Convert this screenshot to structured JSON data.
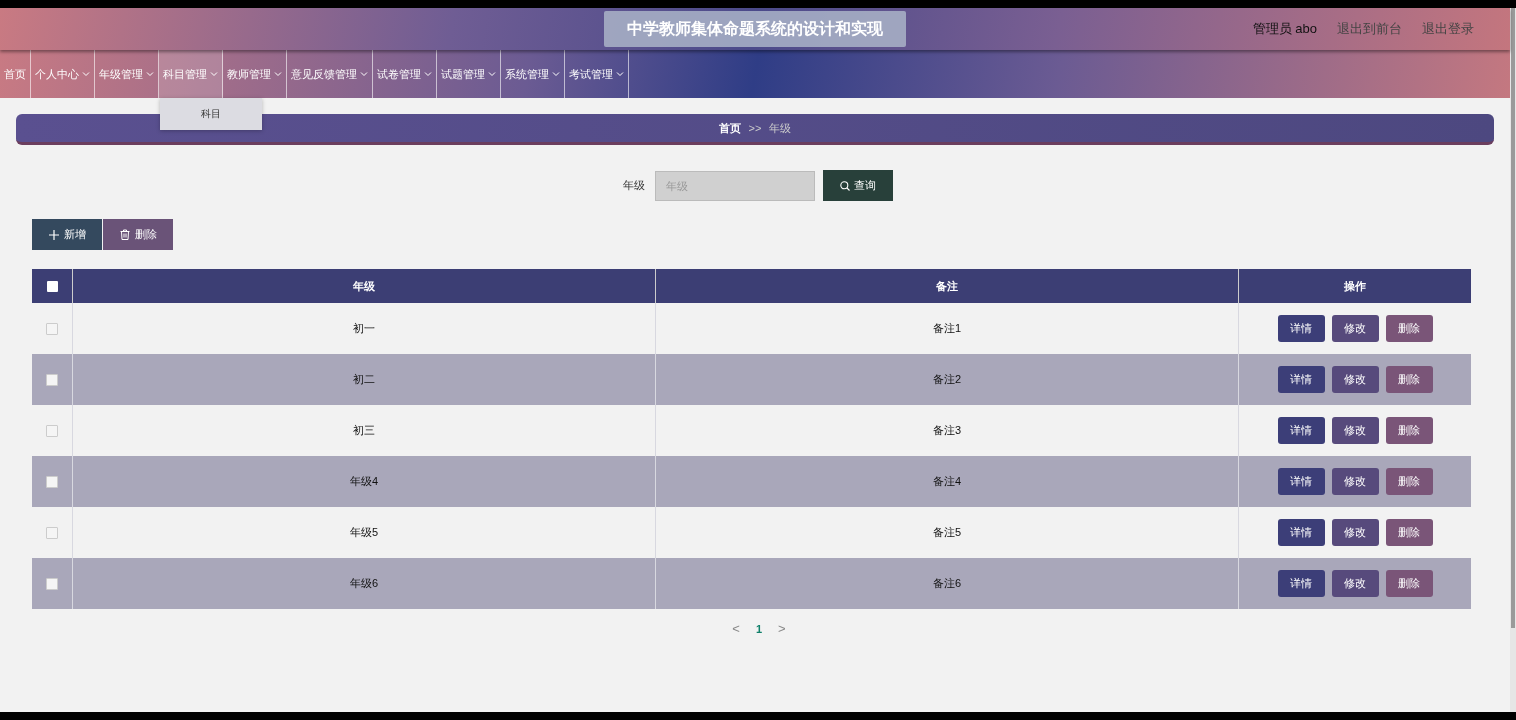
{
  "header": {
    "title": "中学教师集体命题系统的设计和实现",
    "user": "管理员 abo",
    "links": [
      "退出到前台",
      "退出登录"
    ]
  },
  "nav": [
    {
      "label": "首页",
      "has_menu": false,
      "expanded": false
    },
    {
      "label": "个人中心",
      "has_menu": true,
      "expanded": false
    },
    {
      "label": "年级管理",
      "has_menu": true,
      "expanded": false
    },
    {
      "label": "科目管理",
      "has_menu": true,
      "expanded": true,
      "menu": [
        "科目"
      ]
    },
    {
      "label": "教师管理",
      "has_menu": true,
      "expanded": false
    },
    {
      "label": "意见反馈管理",
      "has_menu": true,
      "expanded": false
    },
    {
      "label": "试卷管理",
      "has_menu": true,
      "expanded": false
    },
    {
      "label": "试题管理",
      "has_menu": true,
      "expanded": false
    },
    {
      "label": "系统管理",
      "has_menu": true,
      "expanded": false
    },
    {
      "label": "考试管理",
      "has_menu": true,
      "expanded": false
    }
  ],
  "breadcrumb": {
    "home": "首页",
    "separator": ">>",
    "current": "年级"
  },
  "search": {
    "label": "年级",
    "placeholder": "年级",
    "button": "查询"
  },
  "actions": [
    {
      "kind": "add",
      "label": "新增"
    },
    {
      "kind": "delete",
      "label": "删除"
    }
  ],
  "table": {
    "select_all_checked": false,
    "columns": [
      "年级",
      "备注",
      "操作"
    ],
    "rows": [
      {
        "grade": "初一",
        "note": "备注1",
        "checked": false,
        "buttons": [
          {
            "kind": "detail",
            "label": "详情"
          },
          {
            "kind": "edit",
            "label": "修改"
          },
          {
            "kind": "delete",
            "label": "删除"
          }
        ]
      },
      {
        "grade": "初二",
        "note": "备注2",
        "checked": false,
        "buttons": [
          {
            "kind": "detail",
            "label": "详情"
          },
          {
            "kind": "edit",
            "label": "修改"
          },
          {
            "kind": "delete",
            "label": "删除"
          }
        ]
      },
      {
        "grade": "初三",
        "note": "备注3",
        "checked": false,
        "buttons": [
          {
            "kind": "detail",
            "label": "详情"
          },
          {
            "kind": "edit",
            "label": "修改"
          },
          {
            "kind": "delete",
            "label": "删除"
          }
        ]
      },
      {
        "grade": "年级4",
        "note": "备注4",
        "checked": false,
        "buttons": [
          {
            "kind": "detail",
            "label": "详情"
          },
          {
            "kind": "edit",
            "label": "修改"
          },
          {
            "kind": "delete",
            "label": "删除"
          }
        ]
      },
      {
        "grade": "年级5",
        "note": "备注5",
        "checked": false,
        "buttons": [
          {
            "kind": "detail",
            "label": "详情"
          },
          {
            "kind": "edit",
            "label": "修改"
          },
          {
            "kind": "delete",
            "label": "删除"
          }
        ]
      },
      {
        "grade": "年级6",
        "note": "备注6",
        "checked": false,
        "buttons": [
          {
            "kind": "detail",
            "label": "详情"
          },
          {
            "kind": "edit",
            "label": "修改"
          },
          {
            "kind": "delete",
            "label": "删除"
          }
        ]
      }
    ]
  },
  "pagination": {
    "prev": "<",
    "pages": [
      {
        "label": "1",
        "selected": true
      }
    ],
    "next": ">"
  }
}
